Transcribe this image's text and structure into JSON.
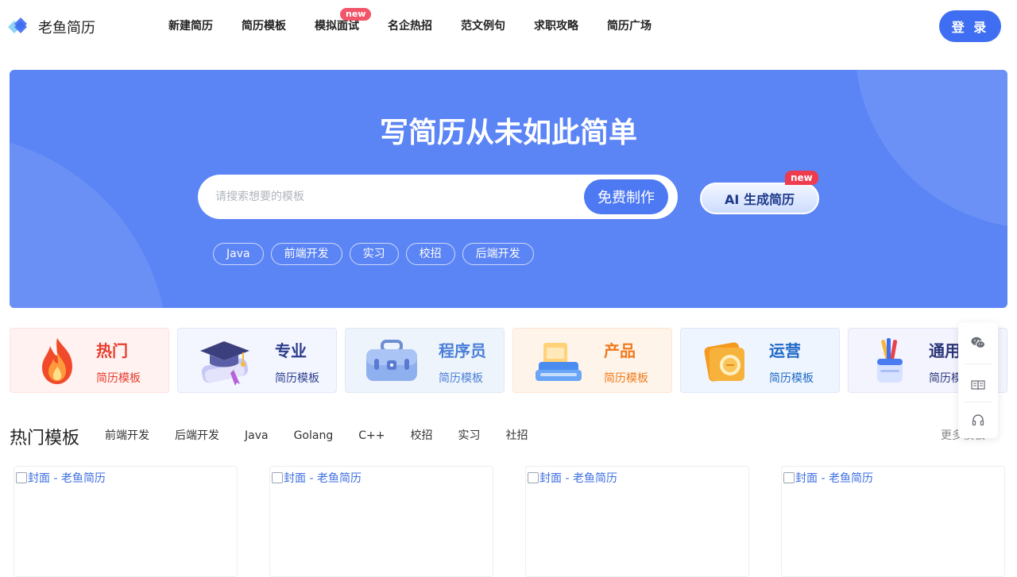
{
  "brand": {
    "name": "老鱼简历"
  },
  "nav": {
    "items": [
      {
        "label": "新建简历"
      },
      {
        "label": "简历模板"
      },
      {
        "label": "模拟面试",
        "badge": "new"
      },
      {
        "label": "名企热招"
      },
      {
        "label": "范文例句"
      },
      {
        "label": "求职攻略"
      },
      {
        "label": "简历广场"
      }
    ],
    "login": "登 录"
  },
  "hero": {
    "title": "写简历从未如此简单",
    "search_placeholder": "请搜索想要的模板",
    "make_button": "免费制作",
    "ai_button": "AI 生成简历",
    "ai_badge": "new",
    "tags": [
      "Java",
      "前端开发",
      "实习",
      "校招",
      "后端开发"
    ]
  },
  "categories": [
    {
      "title": "热门",
      "sub": "简历模板",
      "icon": "flame-icon",
      "color": "#e83c2e",
      "bg": "#fff2f0",
      "border": "#fde2de"
    },
    {
      "title": "专业",
      "sub": "简历模板",
      "icon": "graduation-cap-icon",
      "color": "#2c3e8c",
      "bg": "#f3f5ff",
      "border": "#e1e6fb"
    },
    {
      "title": "程序员",
      "sub": "简历模板",
      "icon": "briefcase-icon",
      "color": "#4a7fd9",
      "bg": "#eef4fb",
      "border": "#dde8f6"
    },
    {
      "title": "产品",
      "sub": "简历模板",
      "icon": "desk-icon",
      "color": "#f07a1c",
      "bg": "#fff4ea",
      "border": "#fde5d1"
    },
    {
      "title": "运营",
      "sub": "简历模板",
      "icon": "coin-folder-icon",
      "color": "#1f69c6",
      "bg": "#eef5ff",
      "border": "#dbe7fb"
    },
    {
      "title": "通用",
      "sub": "简历模板",
      "icon": "pen-holder-icon",
      "color": "#2b3578",
      "bg": "#f3f4fe",
      "border": "#e2e4f8"
    }
  ],
  "sidebar": {
    "icons": [
      "wechat-icon",
      "book-icon",
      "headset-icon"
    ]
  },
  "hot": {
    "title": "热门模板",
    "filters": [
      "前端开发",
      "后端开发",
      "Java",
      "Golang",
      "C++",
      "校招",
      "实习",
      "社招"
    ],
    "more": "更多模板",
    "templates": [
      {
        "alt": "封面 - 老鱼简历"
      },
      {
        "alt": "封面 - 老鱼简历"
      },
      {
        "alt": "封面 - 老鱼简历"
      },
      {
        "alt": "封面 - 老鱼简历"
      }
    ]
  },
  "colors": {
    "primary": "#3f6ef2",
    "hero": "#5b84f5",
    "badge": "#ef3b4e"
  }
}
